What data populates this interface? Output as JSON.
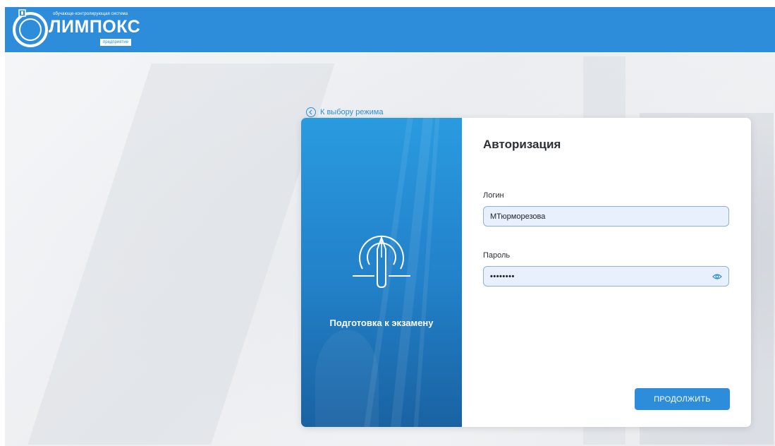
{
  "header": {
    "logo": {
      "tagline": "обучающе-контролирующая система",
      "name": "ЛИМПОКС",
      "badge": "предприятие"
    }
  },
  "back_link": {
    "label": "К выбору режима"
  },
  "mode": {
    "title": "Подготовка к экзамену",
    "icon": "pen-target-icon"
  },
  "form": {
    "title": "Авторизация",
    "login": {
      "label": "Логин",
      "value": "МТюрморезова"
    },
    "password": {
      "label": "Пароль",
      "value": "••••••••",
      "icon": "eye-icon"
    },
    "submit_label": "ПРОДОЛЖИТЬ"
  },
  "colors": {
    "header": "#2e8ddb",
    "accent": "#2e8ddb",
    "field_bg": "#e8f0fe",
    "panel": "#2384cc"
  }
}
